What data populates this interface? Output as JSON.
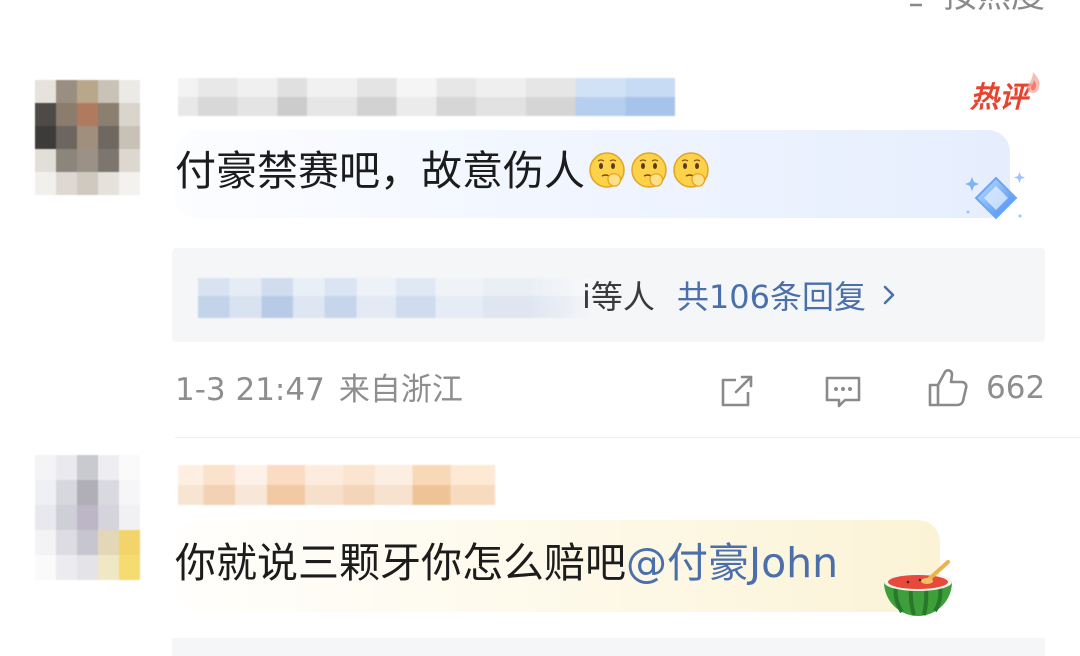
{
  "header": {
    "sort_label": "按热度",
    "sort_icon": "sort-icon"
  },
  "comments": [
    {
      "badge": "热评",
      "text": "付豪禁赛吧，故意伤人",
      "emojis": [
        "thinking-emoji-icon",
        "thinking-emoji-icon",
        "thinking-emoji-icon"
      ],
      "replies": {
        "names_suffix": "i等人",
        "count_label": "共106条回复"
      },
      "time": "1-3 21:47",
      "location": "来自浙江",
      "likes": "662",
      "actions": [
        "share-icon",
        "comment-icon",
        "thumbs-up-icon"
      ]
    },
    {
      "text": "你就说三颗牙你怎么赔吧",
      "mention": "@付豪John"
    }
  ],
  "colors": {
    "text": "#1c1c1c",
    "meta": "#8e8e8e",
    "accent_link": "#4a6fab",
    "badge": "#e8432f",
    "reply_box_bg": "#f5f6f8"
  }
}
